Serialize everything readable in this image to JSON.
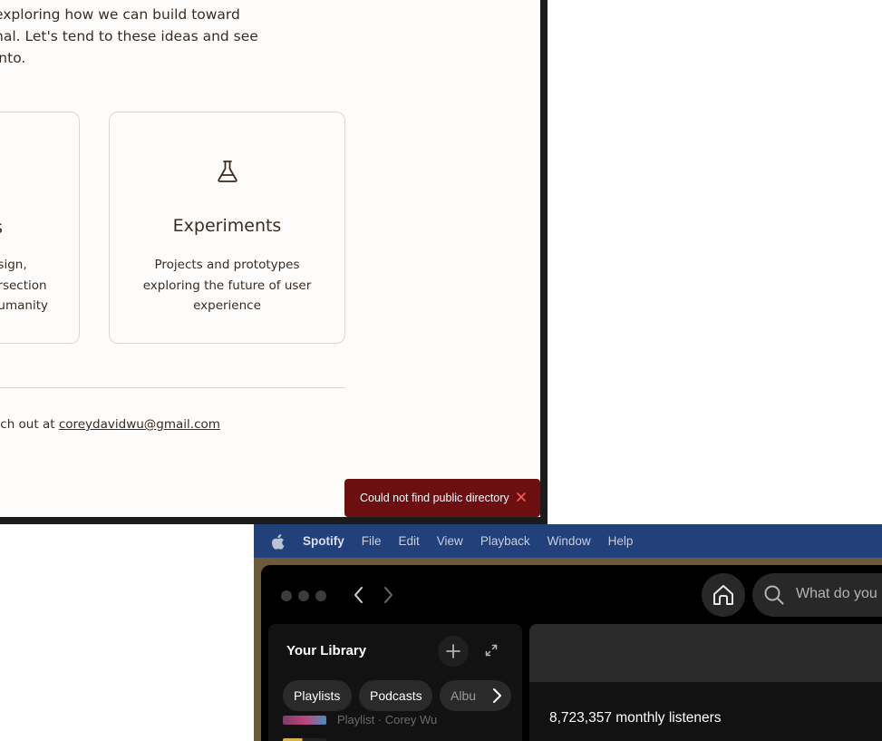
{
  "website": {
    "intro_lines": [
      "exploring how we can build toward",
      "nal. Let's tend to these ideas and see",
      "into."
    ],
    "card_left": {
      "title": "s",
      "desc_lines": [
        "sign,",
        "rsection",
        "umanity"
      ]
    },
    "card_experiments": {
      "icon": "flask-icon",
      "title": "Experiments",
      "desc_lines": [
        "Projects and prototypes",
        "exploring the future of user",
        "experience"
      ]
    },
    "footer_prefix": "ach out at ",
    "footer_email": "coreydavidwu@gmail.com",
    "toast": {
      "message": "Could not find public directory",
      "bg_color": "#6b0f10"
    }
  },
  "spotify": {
    "menubar": {
      "app_name": "Spotify",
      "items": [
        "File",
        "Edit",
        "View",
        "Playback",
        "Window",
        "Help"
      ]
    },
    "search_placeholder": "What do you",
    "library": {
      "title": "Your Library",
      "chips": [
        "Playlists",
        "Podcasts",
        "Albu"
      ],
      "row_partial_text": "Playlist · Corey Wu"
    },
    "main": {
      "monthly_listeners": "8,723,357 monthly listeners"
    }
  }
}
